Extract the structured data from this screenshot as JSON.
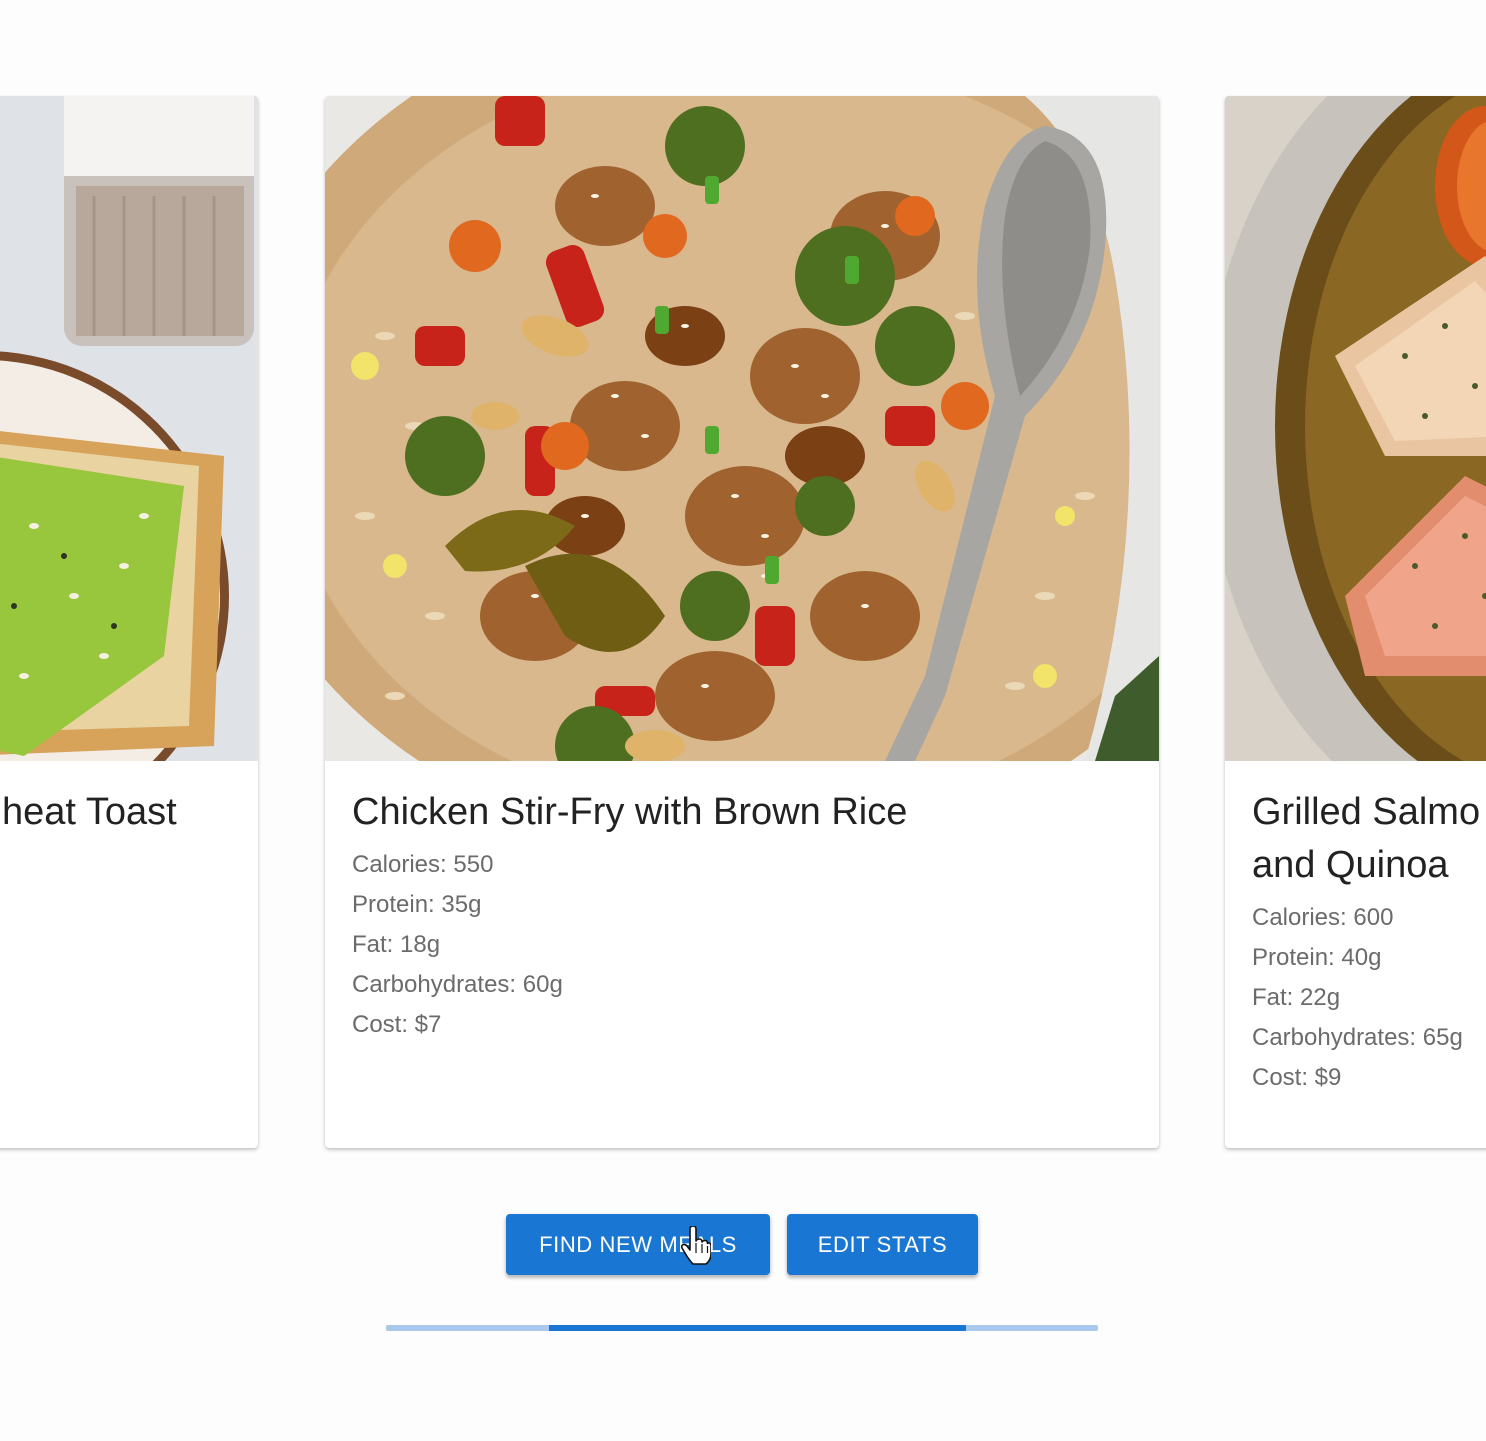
{
  "meals": [
    {
      "title": "Avocado on Whole Wheat Toast",
      "visible_title": "heat Toast",
      "image": "avocado-toast-photo",
      "stats": []
    },
    {
      "title": "Chicken Stir-Fry with Brown Rice",
      "image": "chicken-stir-fry-photo",
      "stats": {
        "calories": "Calories: 550",
        "protein": "Protein: 35g",
        "fat": "Fat: 18g",
        "carbohydrates": "Carbohydrates: 60g",
        "cost": "Cost: $7"
      }
    },
    {
      "title_line1": "Grilled Salmo",
      "title_line2": "and Quinoa",
      "image": "grilled-salmon-photo",
      "stats": {
        "calories": "Calories: 600",
        "protein": "Protein: 40g",
        "fat": "Fat: 22g",
        "carbohydrates": "Carbohydrates: 65g",
        "cost": "Cost: $9"
      }
    }
  ],
  "actions": {
    "find_new_meals": "FIND NEW MEALS",
    "edit_stats": "EDIT STATS"
  },
  "carousel_progress": {
    "start_fraction": 0.229,
    "end_fraction": 0.815
  },
  "colors": {
    "primary": "#1976d2",
    "track": "#a9c9ec"
  }
}
